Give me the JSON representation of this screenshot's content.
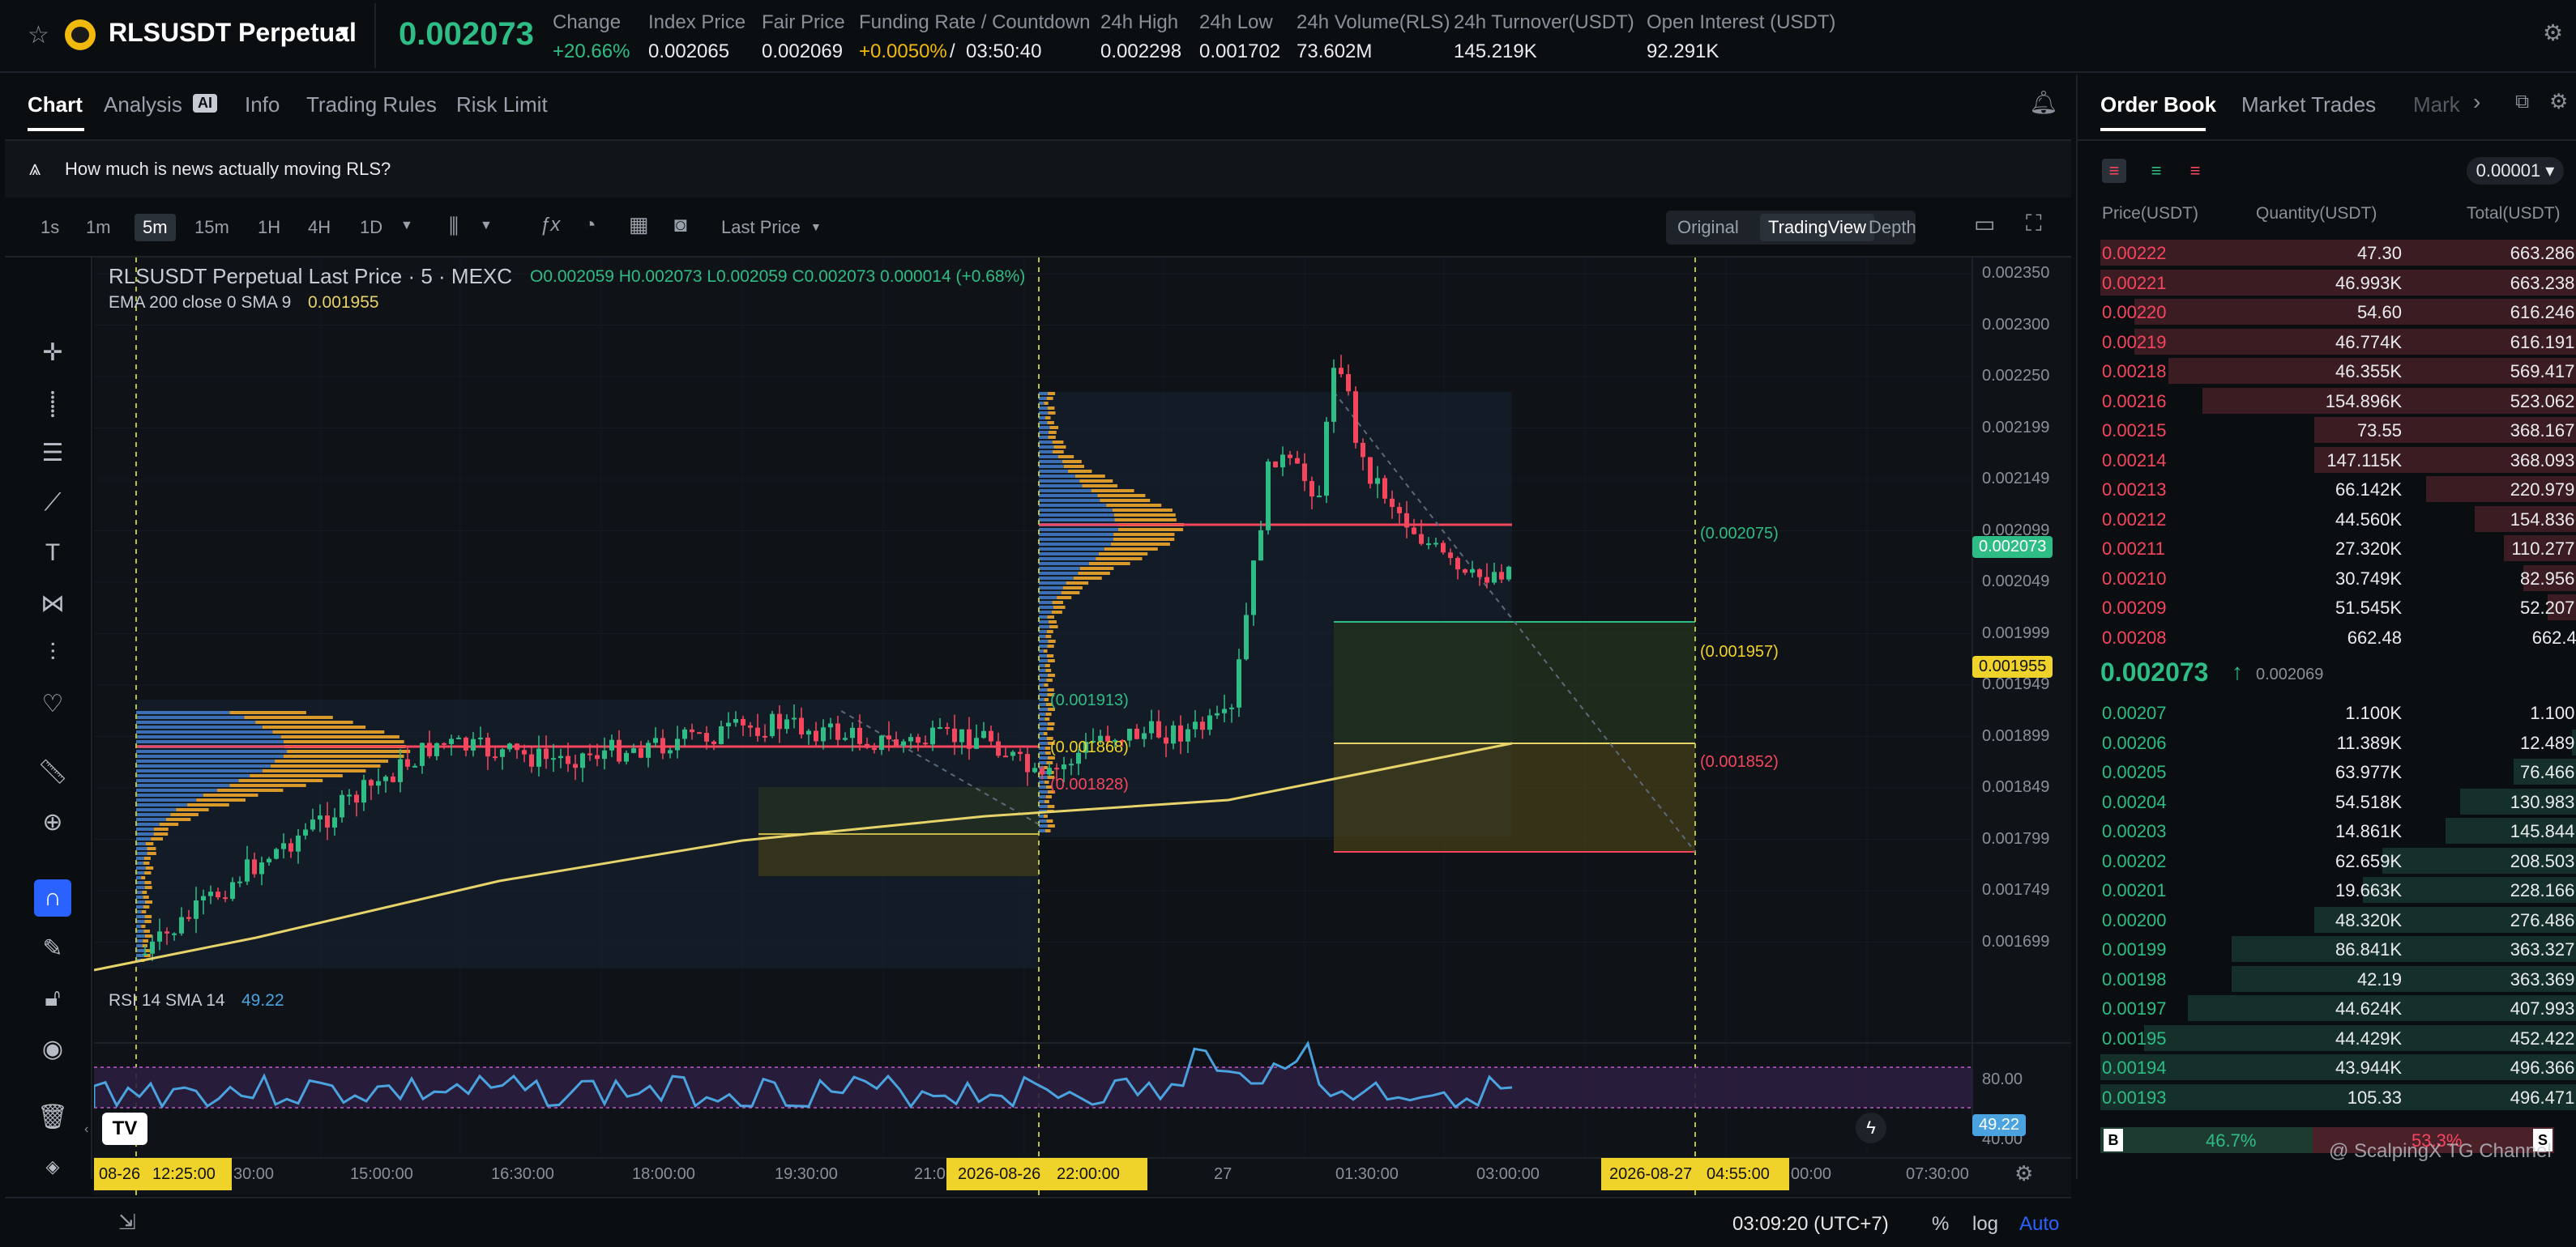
{
  "header": {
    "symbol": "RLSUSDT Perpetual",
    "last_price": "0.002073",
    "stats": [
      {
        "label": "Change",
        "value": "+20.66%"
      },
      {
        "label": "Index Price",
        "value": "0.002065"
      },
      {
        "label": "Fair Price",
        "value": "0.002069"
      },
      {
        "label": "Funding Rate / Countdown",
        "value_rate": "+0.0050%",
        "value_sep": "/",
        "value_time": "03:50:40"
      },
      {
        "label": "24h High",
        "value": "0.002298"
      },
      {
        "label": "24h Low",
        "value": "0.001702"
      },
      {
        "label": "24h Volume(RLS)",
        "value": "73.602M"
      },
      {
        "label": "24h Turnover(USDT)",
        "value": "145.219K"
      },
      {
        "label": "Open Interest (USDT)",
        "value": "92.291K"
      }
    ]
  },
  "chart_tabs": [
    "Chart",
    "Analysis",
    "Info",
    "Trading Rules",
    "Risk Limit"
  ],
  "analysis_badge": "AI",
  "news_prompt": "How much is news actually moving RLS?",
  "timeframes": [
    "1s",
    "1m",
    "5m",
    "15m",
    "1H",
    "4H",
    "1D"
  ],
  "active_timeframe": "5m",
  "price_type": "Last Price",
  "view_modes": [
    "Original",
    "TradingView",
    "Depth"
  ],
  "active_view": "TradingView",
  "legend": {
    "title": "RLSUSDT Perpetual Last Price · 5 · MEXC",
    "ohlc": "O0.002059  H0.002073  L0.002059  C0.002073  0.000014 (+0.68%)",
    "ema_label": "EMA 200 close 0 SMA 9",
    "ema_value": "0.001955"
  },
  "price_axis": [
    "0.002350",
    "0.002300",
    "0.002250",
    "0.002199",
    "0.002149",
    "0.002099",
    "0.002049",
    "0.001999",
    "0.001949",
    "0.001899",
    "0.001849",
    "0.001799",
    "0.001749",
    "0.001699"
  ],
  "price_tags": {
    "last": "0.002073",
    "ema": "0.001955",
    "rsi": "49.22"
  },
  "annotations": [
    "(0.002075)",
    "(0.001957)",
    "(0.001852)",
    "(0.001913)",
    "(0.001868)",
    "(0.001828)"
  ],
  "rsi": {
    "label": "RSI 14 SMA 14",
    "value": "49.22",
    "levels": [
      "80.00",
      "40.00"
    ]
  },
  "time_axis": [
    "08-26",
    "12:25:00",
    "30:00",
    "15:00:00",
    "16:30:00",
    "18:00:00",
    "19:30:00",
    "21:0",
    "2026-08-26",
    "22:00:00",
    "27",
    "01:30:00",
    "03:00:00",
    "2026-08-27",
    "04:55:00",
    "00:00",
    "07:30:00"
  ],
  "footer": {
    "clock": "03:09:20 (UTC+7)",
    "pct": "%",
    "log": "log",
    "auto": "Auto"
  },
  "orderbook": {
    "tabs": [
      "Order Book",
      "Market Trades",
      "Mark"
    ],
    "precision": "0.00001",
    "headers": [
      "Price(USDT)",
      "Quantity(USDT)",
      "Total(USDT)"
    ],
    "asks": [
      {
        "p": "0.00222",
        "q": "47.30",
        "t": "663.286K",
        "d": 1.0
      },
      {
        "p": "0.00221",
        "q": "46.993K",
        "t": "663.238K",
        "d": 1.0
      },
      {
        "p": "0.00220",
        "q": "54.60",
        "t": "616.246K",
        "d": 0.93
      },
      {
        "p": "0.00219",
        "q": "46.774K",
        "t": "616.191K",
        "d": 0.93
      },
      {
        "p": "0.00218",
        "q": "46.355K",
        "t": "569.417K",
        "d": 0.86
      },
      {
        "p": "0.00216",
        "q": "154.896K",
        "t": "523.062K",
        "d": 0.79
      },
      {
        "p": "0.00215",
        "q": "73.55",
        "t": "368.167K",
        "d": 0.56
      },
      {
        "p": "0.00214",
        "q": "147.115K",
        "t": "368.093K",
        "d": 0.56
      },
      {
        "p": "0.00213",
        "q": "66.142K",
        "t": "220.979K",
        "d": 0.33
      },
      {
        "p": "0.00212",
        "q": "44.560K",
        "t": "154.836K",
        "d": 0.23
      },
      {
        "p": "0.00211",
        "q": "27.320K",
        "t": "110.277K",
        "d": 0.17
      },
      {
        "p": "0.00210",
        "q": "30.749K",
        "t": "82.956K",
        "d": 0.13
      },
      {
        "p": "0.00209",
        "q": "51.545K",
        "t": "52.207K",
        "d": 0.08
      },
      {
        "p": "0.00208",
        "q": "662.48",
        "t": "662.48",
        "d": 0.01
      }
    ],
    "mid_price": "0.002073",
    "mid_arrow": "↑",
    "mid_index": "0.002069",
    "bids": [
      {
        "p": "0.00207",
        "q": "1.100K",
        "t": "1.100K",
        "d": 0.01
      },
      {
        "p": "0.00206",
        "q": "11.389K",
        "t": "12.489K",
        "d": 0.03
      },
      {
        "p": "0.00205",
        "q": "63.977K",
        "t": "76.466K",
        "d": 0.15
      },
      {
        "p": "0.00204",
        "q": "54.518K",
        "t": "130.983K",
        "d": 0.26
      },
      {
        "p": "0.00203",
        "q": "14.861K",
        "t": "145.844K",
        "d": 0.29
      },
      {
        "p": "0.00202",
        "q": "62.659K",
        "t": "208.503K",
        "d": 0.42
      },
      {
        "p": "0.00201",
        "q": "19.663K",
        "t": "228.166K",
        "d": 0.46
      },
      {
        "p": "0.00200",
        "q": "48.320K",
        "t": "276.486K",
        "d": 0.56
      },
      {
        "p": "0.00199",
        "q": "86.841K",
        "t": "363.327K",
        "d": 0.73
      },
      {
        "p": "0.00198",
        "q": "42.19",
        "t": "363.369K",
        "d": 0.73
      },
      {
        "p": "0.00197",
        "q": "44.624K",
        "t": "407.993K",
        "d": 0.82
      },
      {
        "p": "0.00195",
        "q": "44.429K",
        "t": "452.422K",
        "d": 0.91
      },
      {
        "p": "0.00194",
        "q": "43.944K",
        "t": "496.366K",
        "d": 1.0
      },
      {
        "p": "0.00193",
        "q": "105.33",
        "t": "496.471K",
        "d": 1.0
      }
    ],
    "ratio": {
      "buy_label": "B",
      "buy": "46.7%",
      "sell": "53.3%",
      "sell_label": "S",
      "buy_fraction": 0.467
    },
    "watermark": "@ ScalpingX TG Channel"
  },
  "colors": {
    "up": "#2ebd85",
    "down": "#f6465d",
    "accent": "#f0b90b",
    "ema": "#e6d36a"
  }
}
